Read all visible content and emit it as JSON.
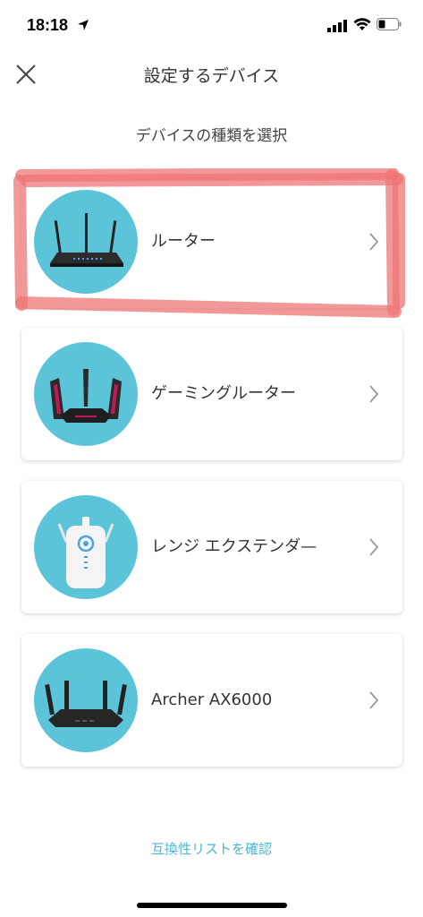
{
  "status": {
    "time": "18:18",
    "location_icon": "location-arrow-icon",
    "signal_icon": "cellular-signal-icon",
    "wifi_icon": "wifi-icon",
    "battery_icon": "battery-icon"
  },
  "nav": {
    "close_icon": "close-icon",
    "title": "設定するデバイス"
  },
  "subtitle": "デバイスの種類を選択",
  "devices": [
    {
      "label": "ルーター",
      "icon": "router-icon"
    },
    {
      "label": "ゲーミングルーター",
      "icon": "gaming-router-icon"
    },
    {
      "label": "レンジ エクステンダ—",
      "icon": "range-extender-icon"
    },
    {
      "label": "Archer AX6000",
      "icon": "archer-router-icon"
    }
  ],
  "compat_link": "互換性リストを確認",
  "colors": {
    "icon_bg": "#5bc4d9",
    "link": "#4bb8d0",
    "highlight": "#f08080"
  }
}
